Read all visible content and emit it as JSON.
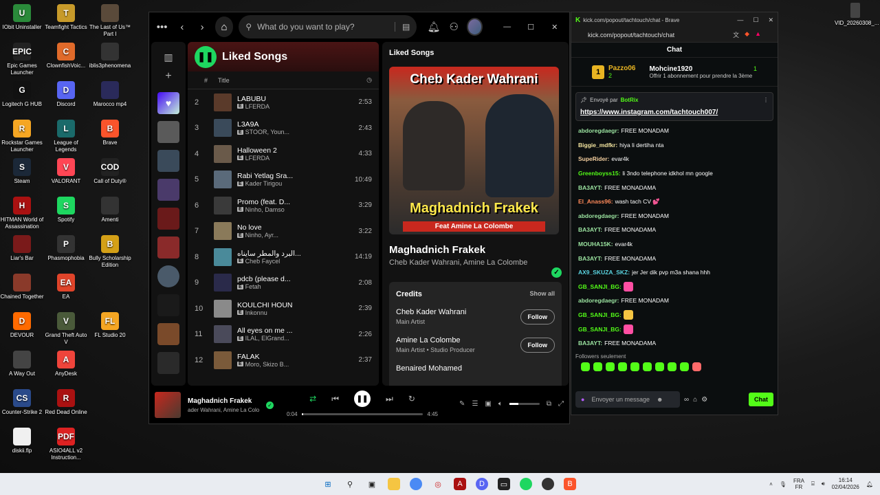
{
  "desktop": {
    "icons": [
      {
        "label": "IObit Uninstaller",
        "color": "#2a8a3a",
        "glyph": "U"
      },
      {
        "label": "Teamfight Tactics",
        "color": "#c79a2a",
        "glyph": "T"
      },
      {
        "label": "The Last of Us™ Part I",
        "color": "#5a4a3a",
        "glyph": ""
      },
      {
        "label": "Epic Games Launcher",
        "color": "#222",
        "glyph": "EPIC"
      },
      {
        "label": "ClownfishVoic...",
        "color": "#e06a2a",
        "glyph": "C"
      },
      {
        "label": "iblis3phenomena",
        "color": "#333",
        "glyph": ""
      },
      {
        "label": "Logitech G HUB",
        "color": "#111",
        "glyph": "G"
      },
      {
        "label": "Discord",
        "color": "#5865f2",
        "glyph": "D"
      },
      {
        "label": "Marocco mp4",
        "color": "#2a2a5a",
        "glyph": ""
      },
      {
        "label": "Rockstar Games Launcher",
        "color": "#f5a623",
        "glyph": "R"
      },
      {
        "label": "League of Legends",
        "color": "#1a6a6a",
        "glyph": "L"
      },
      {
        "label": "Brave",
        "color": "#fb542b",
        "glyph": "B"
      },
      {
        "label": "Steam",
        "color": "#1b2838",
        "glyph": "S"
      },
      {
        "label": "VALORANT",
        "color": "#ff4655",
        "glyph": "V"
      },
      {
        "label": "Call of Duty®",
        "color": "#222",
        "glyph": "COD"
      },
      {
        "label": "HITMAN World of Assassination",
        "color": "#aa1111",
        "glyph": "H"
      },
      {
        "label": "Spotify",
        "color": "#1ed760",
        "glyph": "S"
      },
      {
        "label": "Amenti",
        "color": "#333",
        "glyph": ""
      },
      {
        "label": "Liar's Bar",
        "color": "#7a1a1a",
        "glyph": ""
      },
      {
        "label": "Phasmophobia",
        "color": "#333",
        "glyph": "P"
      },
      {
        "label": "Bully Scholarship Edition",
        "color": "#d4a017",
        "glyph": "B"
      },
      {
        "label": "Chained Together",
        "color": "#8a3a2a",
        "glyph": ""
      },
      {
        "label": "EA",
        "color": "#e0442a",
        "glyph": "EA"
      },
      {
        "label": "",
        "color": "transparent",
        "glyph": ""
      },
      {
        "label": "DEVOUR",
        "color": "#ff6a00",
        "glyph": "D"
      },
      {
        "label": "Grand Theft Auto V",
        "color": "#4a5a3a",
        "glyph": "V"
      },
      {
        "label": "FL Studio 20",
        "color": "#f5a623",
        "glyph": "FL"
      },
      {
        "label": "A Way Out",
        "color": "#444",
        "glyph": ""
      },
      {
        "label": "AnyDesk",
        "color": "#ef443b",
        "glyph": "A"
      },
      {
        "label": "",
        "color": "transparent",
        "glyph": ""
      },
      {
        "label": "Counter-Strike 2",
        "color": "#2a4a8a",
        "glyph": "CS"
      },
      {
        "label": "Red Dead Online",
        "color": "#aa1111",
        "glyph": "R"
      },
      {
        "label": "",
        "color": "transparent",
        "glyph": ""
      },
      {
        "label": "diskii.flp",
        "color": "#f0f0f0",
        "glyph": ""
      },
      {
        "label": "ASIO4ALL v2 Instruction...",
        "color": "#d22",
        "glyph": "PDF"
      }
    ],
    "right_icon_label": "VID_20260308_..."
  },
  "spotify": {
    "search_placeholder": "What do you want to play?",
    "playlist_title": "Liked Songs",
    "col_num": "#",
    "col_title": "Title",
    "tracks": [
      {
        "num": "2",
        "name": "LABUBU",
        "artist": "LFERDA",
        "dur": "2:53",
        "color": "#5a3a2a"
      },
      {
        "num": "3",
        "name": "L3A9A",
        "artist": "STOOR, Youn...",
        "dur": "2:43",
        "color": "#3a4a5a"
      },
      {
        "num": "4",
        "name": "Halloween 2",
        "artist": "LFERDA",
        "dur": "4:33",
        "color": "#6a5a4a"
      },
      {
        "num": "5",
        "name": "Rabi Yetlag Sra...",
        "artist": "Kader Tirigou",
        "dur": "10:49",
        "color": "#5a6a7a"
      },
      {
        "num": "6",
        "name": "Promo (feat. D...",
        "artist": "Ninho, Damso",
        "dur": "3:29",
        "color": "#3a3a3a"
      },
      {
        "num": "7",
        "name": "No love",
        "artist": "Ninho, Ayr...",
        "dur": "3:22",
        "color": "#8a7a5a"
      },
      {
        "num": "8",
        "name": "البرد والمطر سايناه...",
        "artist": "Cheb Faycel",
        "dur": "14:19",
        "color": "#4a8a9a"
      },
      {
        "num": "9",
        "name": "pdcb (please d...",
        "artist": "Fetah",
        "dur": "2:08",
        "color": "#2a2a4a"
      },
      {
        "num": "10",
        "name": "KOULCHI HOUN",
        "artist": "Inkonnu",
        "dur": "2:39",
        "color": "#8a8a8a"
      },
      {
        "num": "11",
        "name": "All eyes on me ...",
        "artist": "ILAL, ElGrand...",
        "dur": "2:26",
        "color": "#4a4a5a"
      },
      {
        "num": "12",
        "name": "FALAK",
        "artist": "Moro, Skizo B...",
        "dur": "2:37",
        "color": "#7a5a3a"
      }
    ],
    "panel_title": "Liked Songs",
    "cover_top": "Cheb Kader Wahrani",
    "cover_bottom": "Maghadnich Frakek",
    "cover_feat": "Feat Amine La Colombe",
    "song_title": "Maghadnich Frakek",
    "song_artist": "Cheb Kader Wahrani, Amine La Colombe",
    "credits_title": "Credits",
    "show_all": "Show all",
    "credits": [
      {
        "name": "Cheb Kader Wahrani",
        "role": "Main Artist",
        "button": "Follow"
      },
      {
        "name": "Amine La Colombe",
        "role": "Main Artist • Studio Producer",
        "button": "Follow"
      },
      {
        "name": "Benaired Mohamed",
        "role": "",
        "button": ""
      }
    ],
    "now_playing_title": "Maghadnich Frakek",
    "now_playing_artist": "ader Wahrani, Amine La Colo",
    "elapsed": "0:04",
    "total": "4:45",
    "progress": 0.014,
    "volume": 0.3
  },
  "brave": {
    "tab_title": "kick.com/popout/tachtouch/chat - Brave",
    "url": "kick.com/popout/tachtouch/chat",
    "chat_title": "Chat",
    "top_gifter_rank": "1",
    "top_gifter": "Pazzo06",
    "top_gifter_count": "2",
    "second_gifter": "Mohcine1920",
    "second_gifter_count": "1",
    "sub_text": "Offrir 1 abonnement pour prendre la 3ème",
    "pinned_by": "Envoyé par",
    "pinned_bot": "BotRix",
    "pinned_link": "https://www.instagram.com/tachtouch007/",
    "messages": [
      {
        "user": "abdoregdaegr:",
        "text": "FREE MONADAM",
        "color": "#9be3a0"
      },
      {
        "user": "Biggie_mdfkr:",
        "text": "hiya li dertiha nta",
        "color": "#f5e6a0"
      },
      {
        "user": "SupeRider:",
        "text": "evar4k",
        "color": "#f5d0a0"
      },
      {
        "user": "Greenboyss15:",
        "text": "li 3ndo telephone idkhol mn google",
        "color": "#53fc18"
      },
      {
        "user": "BA3AYT:",
        "text": "FREE MONADAMA",
        "color": "#9be3a0"
      },
      {
        "user": "El_Anass96:",
        "text": "wash tach CV 💕",
        "color": "#ff8a5a"
      },
      {
        "user": "abdoregdaegr:",
        "text": "FREE MONADAM",
        "color": "#9be3a0"
      },
      {
        "user": "BA3AYT:",
        "text": "FREE MONADAMA",
        "color": "#9be3a0"
      },
      {
        "user": "MOUHA15K:",
        "text": "evar4k",
        "color": "#9be3a0"
      },
      {
        "user": "BA3AYT:",
        "text": "FREE MONADAMA",
        "color": "#9be3a0"
      },
      {
        "user": "AX9_SKUZA_SKZ:",
        "text": "jer Jer dik pvp m3a shana hhh",
        "color": "#5ad4e0"
      },
      {
        "user": "GB_SANJI_BG:",
        "text": "",
        "color": "#53fc18",
        "emote": "#ff4fa3"
      },
      {
        "user": "abdoregdaegr:",
        "text": "FREE MONADAM",
        "color": "#9be3a0"
      },
      {
        "user": "GB_SANJI_BG:",
        "text": "",
        "color": "#53fc18",
        "emote": "#f5c542"
      },
      {
        "user": "GB_SANJI_BG:",
        "text": "",
        "color": "#53fc18",
        "emote": "#ff4fa3"
      },
      {
        "user": "BA3AYT:",
        "text": "FREE MONADAMA",
        "color": "#9be3a0"
      }
    ],
    "followers_only": "Followers seulement",
    "input_placeholder": "Envoyer un message",
    "chat_button": "Chat"
  },
  "taskbar": {
    "lang_top": "FRA",
    "lang_bottom": "FR",
    "time": "16:14",
    "date": "02/04/2026"
  }
}
